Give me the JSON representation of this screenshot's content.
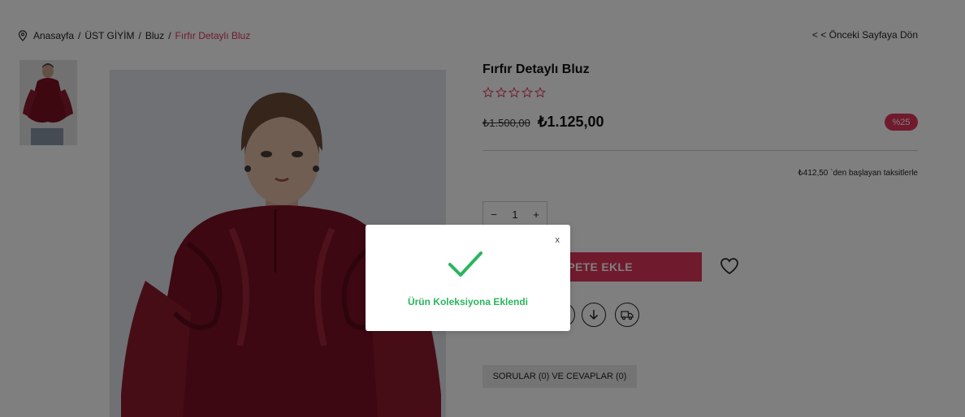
{
  "breadcrumb": {
    "items": [
      "Anasayfa",
      "ÜST GİYİM",
      "Bluz"
    ],
    "current": "Fırfır Detaylı Bluz",
    "separator": "/"
  },
  "back_link": "< < Önceki Sayfaya Dön",
  "product": {
    "title": "Fırfır Detaylı Bluz",
    "rating": 0,
    "rating_max": 5,
    "old_price": "₺1.500,00",
    "price": "₺1.125,00",
    "discount": "%25",
    "installment": "₺412,50 `den başlayan taksitlerle",
    "quantity": "1",
    "qty_minus": "−",
    "qty_plus": "+",
    "add_to_cart": "SEPETE EKLE"
  },
  "tabs": {
    "qa": "SORULAR (0) VE CEVAPLAR (0)"
  },
  "modal": {
    "close": "x",
    "message": "Ürün Koleksiyona Eklendi"
  },
  "icons": {
    "pin": "location-pin-icon",
    "star": "star-outline-icon",
    "heart": "heart-outline-icon",
    "download": "arrow-down-circle-icon",
    "shipping": "truck-icon",
    "check": "checkmark-icon"
  },
  "colors": {
    "accent": "#e0365a",
    "success": "#2bb55d",
    "overlay": "rgba(0,0,0,0.5)"
  }
}
